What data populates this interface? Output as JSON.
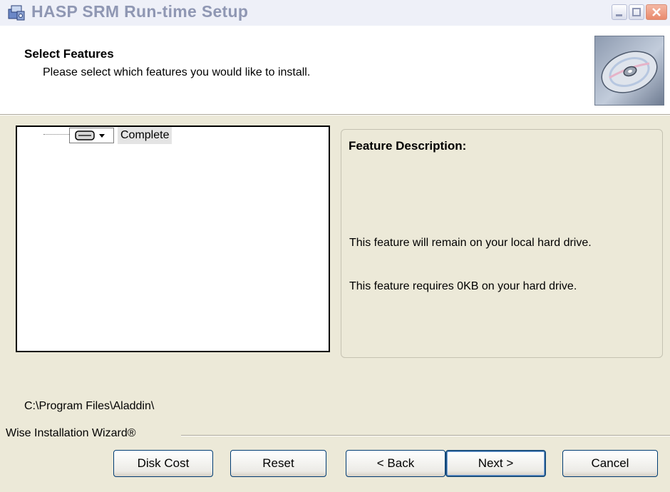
{
  "window": {
    "title": "HASP SRM Run-time Setup",
    "icon": "setup-icon",
    "controls": [
      "minimize-icon",
      "maximize-icon",
      "close-icon"
    ]
  },
  "header": {
    "title": "Select Features",
    "subtitle": "Please select which features you would like to install.",
    "icon": "cd-icon"
  },
  "feature_tree": {
    "items": [
      {
        "label": "Complete",
        "icon": "hard-drive-icon"
      }
    ]
  },
  "description": {
    "title": "Feature Description:",
    "line1": "This feature will remain on your local hard drive.",
    "line2": "This feature requires 0KB on your hard drive."
  },
  "install_path": "C:\\Program Files\\Aladdin\\",
  "brand": "Wise Installation Wizard®",
  "buttons": {
    "disk_cost": "Disk Cost",
    "reset": "Reset",
    "back": "< Back",
    "next": "Next >",
    "cancel": "Cancel"
  },
  "colors": {
    "dialog_bg": "#ece9d8",
    "header_bg": "#ffffff",
    "title_text": "#8f97b3",
    "button_border": "#003c74"
  }
}
